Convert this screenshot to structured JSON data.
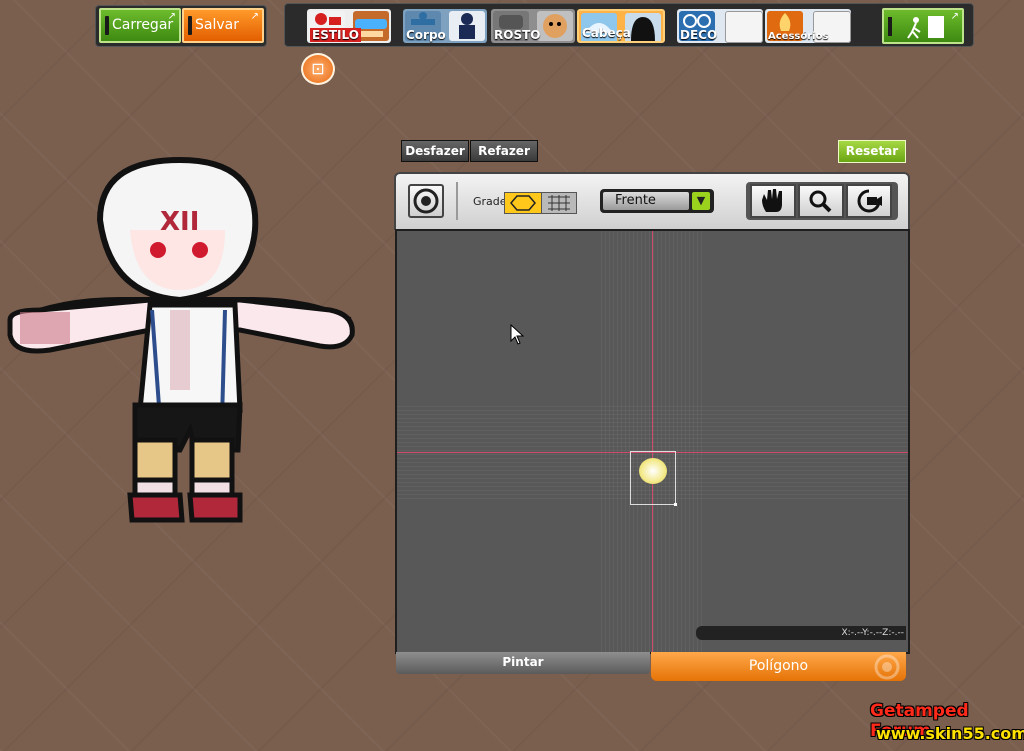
{
  "top_left": {
    "load_label": "Carregar",
    "save_label": "Salvar"
  },
  "categories": [
    {
      "label": "ESTILO",
      "label_color": "#d62020",
      "icon": "style-icon"
    },
    {
      "label": "Corpo",
      "label_color": "#2f6ea3",
      "icon": "body-icon"
    },
    {
      "label": "ROSTO",
      "label_color": "#4e4e4e",
      "icon": "face-icon"
    },
    {
      "label": "Cabeça",
      "label_color": "#2c7fc7",
      "icon": "head-icon",
      "selected": true
    },
    {
      "label": "DECO",
      "label_color": "#2c6fb0",
      "icon": "glasses-icon"
    },
    {
      "label": "Acessórios",
      "label_color": "#e06a10",
      "icon": "fire-icon"
    }
  ],
  "exit_icon": "exit-icon",
  "editor": {
    "undo_label": "Desfazer",
    "redo_label": "Refazer",
    "reset_label": "Resetar",
    "grid_label": "Grade",
    "view_select": "Frente",
    "tools": [
      "hand-icon",
      "zoom-icon",
      "rotate-camera-icon"
    ],
    "coords_text": "X:-.--Y:-.--Z:-.--",
    "tab_paint": "Pintar",
    "tab_polygon": "Polígono"
  },
  "watermark": {
    "line1": "Getamped Forum",
    "line2": "www.skin55.com"
  }
}
